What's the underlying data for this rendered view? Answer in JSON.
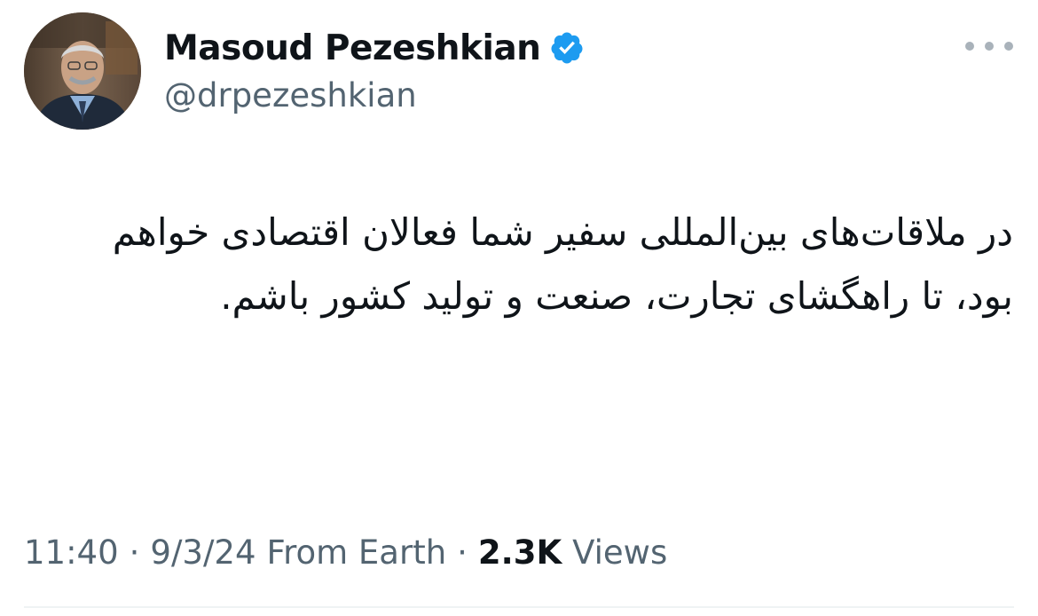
{
  "author": {
    "display_name": "Masoud Pezeshkian",
    "handle": "@drpezeshkian",
    "verified": true,
    "verified_color": "#1d9bf0",
    "avatar_icon": "profile-photo"
  },
  "tweet": {
    "text": "در ملاقات‌های بین‌المللی سفیر شما فعالان اقتصادی خواهم بود، تا راهگشای تجارت، صنعت و تولید کشور باشم."
  },
  "meta": {
    "time": "11:40",
    "date": "9/3/24",
    "source": "From Earth",
    "separator": "·",
    "views_count": "2.3K",
    "views_label": "Views"
  },
  "menu": {
    "icon": "more-options-icon"
  },
  "colors": {
    "text_primary": "#0f1419",
    "text_secondary": "#536471",
    "divider": "#eff3f4"
  }
}
